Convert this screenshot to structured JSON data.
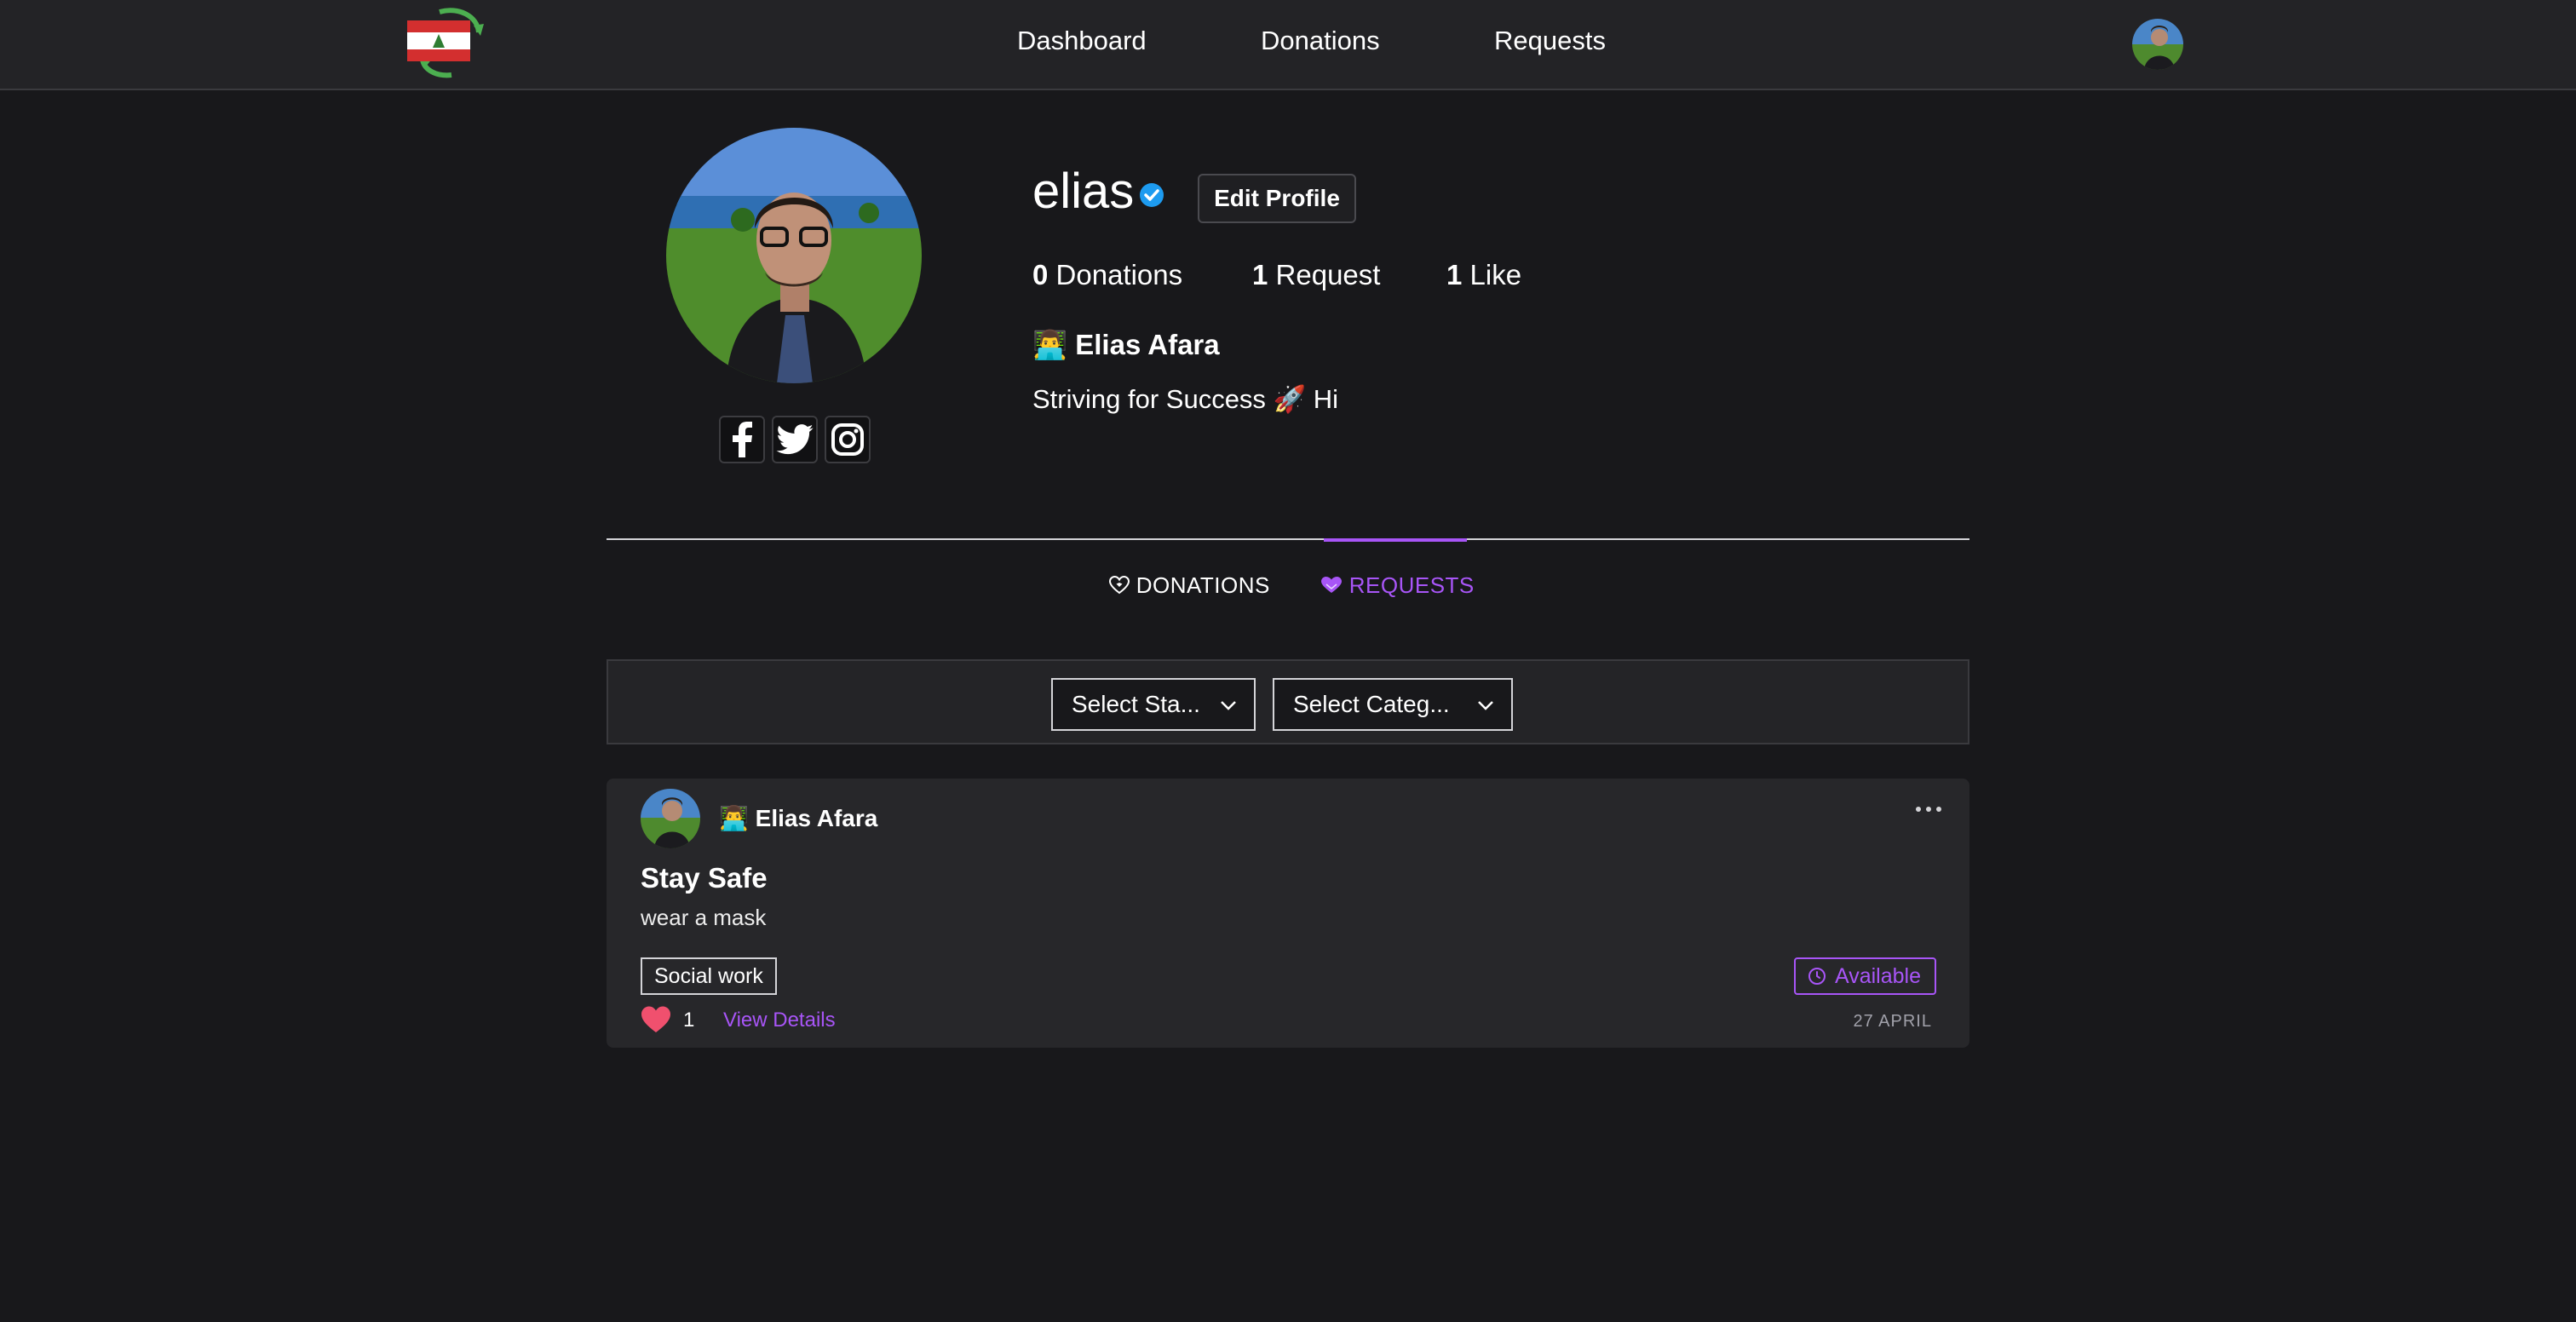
{
  "nav": {
    "links": [
      "Dashboard",
      "Donations",
      "Requests"
    ]
  },
  "profile": {
    "username": "elias",
    "edit_label": "Edit Profile",
    "stats": [
      {
        "count": "0",
        "label": "Donations"
      },
      {
        "count": "1",
        "label": "Request"
      },
      {
        "count": "1",
        "label": "Like"
      }
    ],
    "full_name": "👨‍💻 Elias Afara",
    "bio": "Striving for Success 🚀 Hi",
    "social_icons": [
      "facebook-icon",
      "twitter-icon",
      "instagram-icon"
    ]
  },
  "tabs": [
    {
      "label": "DONATIONS",
      "active": false
    },
    {
      "label": "REQUESTS",
      "active": true
    }
  ],
  "filters": {
    "status_placeholder": "Select Sta...",
    "category_placeholder": "Select Categ..."
  },
  "card": {
    "author": "👨‍💻 Elias Afara",
    "title": "Stay Safe",
    "description": "wear a mask",
    "tag": "Social work",
    "status": "Available",
    "likes": "1",
    "view_details_label": "View Details",
    "date": "27 APRIL"
  },
  "colors": {
    "background": "#18181b",
    "navbar": "#232326",
    "accent": "#a855f7",
    "like": "#f0506e",
    "verified": "#1d9bf0"
  }
}
